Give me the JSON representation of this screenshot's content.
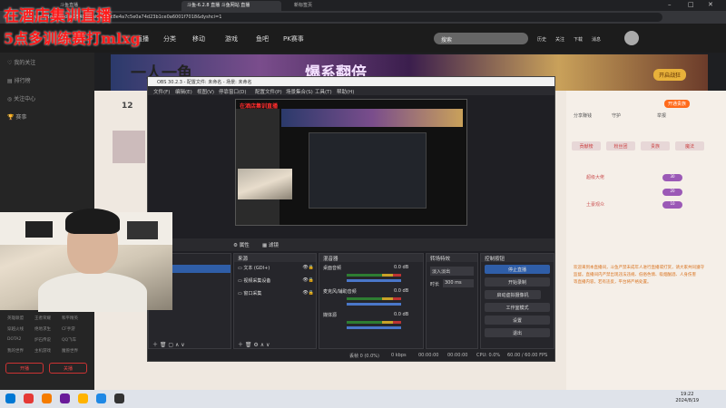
{
  "colors": {
    "accent_red": "#ff1a1a",
    "obs_primary": "#2f5ea8",
    "site_orange": "#f07f3a"
  },
  "browser": {
    "tabs": [
      {
        "label": "斗鱼直播"
      },
      {
        "label": "斗鱼-6.2.8 直播 斗鱼网站 直播"
      },
      {
        "label": "新标签页"
      }
    ],
    "address": "www.douyu.com/2548?dyshid=f8c8e4a7c5e0a74d23b1ce0a6001f7018&dyshci=1",
    "controls": {
      "minimize": "–",
      "maximize": "□",
      "close": "✕"
    }
  },
  "overlay": {
    "line1": "在酒店集训直播",
    "line2": "5点多训练赛打mlxg"
  },
  "site": {
    "nav": [
      "直播",
      "分类",
      "移动",
      "游戏",
      "鱼吧",
      "PK赛事"
    ],
    "search_placeholder": "搜索",
    "user_items": [
      "历史",
      "关注",
      "下载",
      "消息"
    ]
  },
  "sidebar": {
    "items": [
      "我的关注",
      "排行榜",
      "关注中心",
      "赛事"
    ],
    "links": [
      [
        "英雄联盟",
        "王者荣耀",
        "和平精英"
      ],
      [
        "穿越火线",
        "绝地求生",
        "CF手游"
      ],
      [
        "DOTA2",
        "炉石传说",
        "QQ飞车"
      ],
      [
        "我的世界",
        "主机游戏",
        "魔兽世界"
      ]
    ],
    "buttons": [
      "开播",
      "关播"
    ]
  },
  "banner": {
    "title1": "一人一鱼",
    "title2": "爆系翻倍",
    "cta": "开启战狂"
  },
  "main": {
    "count": "12"
  },
  "obs": {
    "title": "OBS 30.2.3 - 配置文件: 未命名 - 场景: 未命名",
    "menu": [
      "文件(F)",
      "编辑(E)",
      "视图(V)",
      "停靠窗口(D)",
      "配置文件(P)",
      "场景集合(S)",
      "工具(T)",
      "帮助(H)"
    ],
    "nested_title": "在酒店集训直播",
    "toolbar": {
      "properties": "属性",
      "filters": "滤镜"
    },
    "docks": {
      "sources": "来源",
      "mixer": "混音器",
      "transitions": "转场特效",
      "controls": "控制按钮"
    },
    "sources": [
      {
        "label": "文本 (GDI+)"
      },
      {
        "label": "视频采集设备"
      },
      {
        "label": "窗口采集"
      }
    ],
    "mixer": [
      {
        "label": "桌面音频",
        "db": "0.0 dB"
      },
      {
        "label": "麦克风/辅助音频",
        "db": "0.0 dB"
      },
      {
        "label": "媒体源",
        "db": "0.0 dB"
      }
    ],
    "transition": {
      "type": "淡入淡出",
      "duration_label": "时长",
      "duration": "300 ms"
    },
    "controls": [
      "停止直播",
      "开始录制",
      "启动虚拟摄像机",
      "工作室模式",
      "设置",
      "退出"
    ],
    "status": {
      "dropped": "丢帧 0 (0.0%)",
      "kbps": "0 kbps",
      "stream_time": "00:00:00",
      "rec_time": "00:00:00",
      "cpu": "CPU: 0.0%",
      "fps": "60.00 / 60.00 FPS"
    }
  },
  "right": {
    "stat_labels": [
      "分享赚钱",
      "守护",
      "举报"
    ],
    "gift_bar": "开通贵族",
    "tabs": [
      "贡献榜",
      "粉丝团",
      "贵族",
      "魔法"
    ],
    "chat": [
      "欢迎来到本直播间，斗鱼严禁未成年人进行直播或打赏，请大家共同遵守",
      "监督。直播间内严禁出现违法违规、低俗色情、吸烟酗酒、人身伤害",
      "等直播内容，若有违反，平台将严格处置。"
    ],
    "user_mentions": [
      "超级大佬",
      "土豪观众"
    ],
    "gift_counts": [
      "30",
      "20",
      "10"
    ]
  },
  "clock": {
    "time": "19:22",
    "date": "2024/8/19"
  }
}
